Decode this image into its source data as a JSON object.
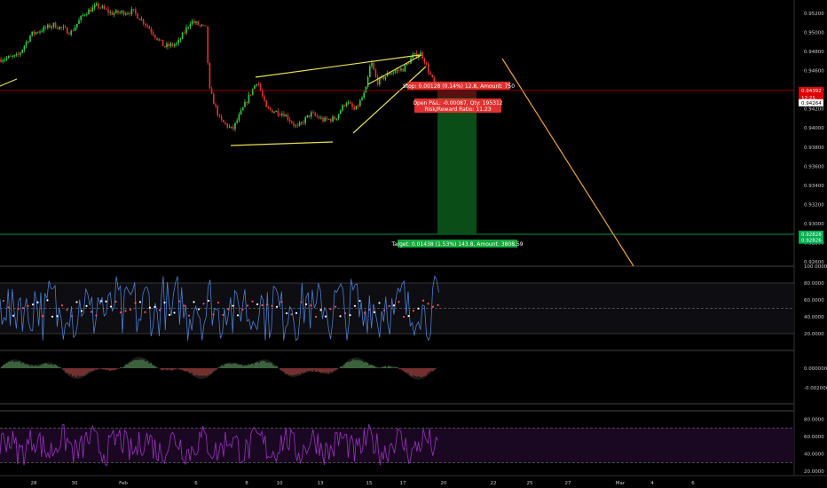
{
  "chart_data": {
    "type": "candlestick",
    "price_axis": {
      "min": 0.926,
      "max": 0.952,
      "ticks": [
        "0.95200",
        "0.95000",
        "0.94800",
        "0.94600",
        "0.94400",
        "0.94200",
        "0.94000",
        "0.93800",
        "0.93600",
        "0.93400",
        "0.93200",
        "0.93000",
        "0.92800",
        "0.92600"
      ],
      "tick_values": [
        0.952,
        0.95,
        0.948,
        0.946,
        0.944,
        0.942,
        0.94,
        0.938,
        0.936,
        0.934,
        0.932,
        0.93,
        0.928,
        0.926
      ]
    },
    "price_markers": [
      {
        "label": "0.94392",
        "value": 0.94392,
        "color": "#e00000"
      },
      {
        "label": "12:25",
        "value": 0.9432,
        "color": "#e00000"
      },
      {
        "label": "0.94264",
        "value": 0.94264,
        "color": "#ffffff",
        "text": "#000000"
      },
      {
        "label": "0.92828",
        "value": 0.92888,
        "color": "#00b050"
      },
      {
        "label": "0.92826",
        "value": 0.92826,
        "color": "#00b050"
      }
    ],
    "x_axis_labels": [
      "28",
      "30",
      "Feb",
      "6",
      "8",
      "10",
      "13",
      "15",
      "17",
      "20",
      "22",
      "25",
      "27",
      "Mar",
      "4",
      "6"
    ],
    "x_axis_positions": [
      38,
      84,
      139,
      221,
      278,
      315,
      361,
      416,
      454,
      500,
      556,
      597,
      640,
      699,
      735,
      781
    ],
    "position": {
      "entry": 0.9432,
      "stop": 0.94448,
      "target": 0.92888,
      "stop_label": "Stop: 0.00128 (0.14%) 12.8, Amount: 750",
      "open_label": "Open P&L: -0.00087, Qty: 195312",
      "rr_label": "Risk/Reward Ratio: 11.23",
      "target_label": "Target: 0.01438 (1.53%) 143.8, Amount: 3808.59"
    },
    "oscillator1": {
      "ticks": [
        "100.0000",
        "80.0000",
        "60.0000",
        "40.0000",
        "20.0000"
      ],
      "tick_values": [
        100,
        80,
        60,
        40,
        20
      ],
      "levels": [
        80,
        50,
        20
      ]
    },
    "oscillator2": {
      "ticks": [
        "0.000000",
        "-0.002000"
      ],
      "tick_values": [
        0,
        -0.002
      ]
    },
    "oscillator3": {
      "ticks": [
        "80.0000",
        "60.0000",
        "40.0000",
        "20.0000"
      ],
      "tick_values": [
        80,
        60,
        40,
        20
      ]
    },
    "colors": {
      "up": "#2ecc40",
      "down": "#e0312e",
      "wedge": "#e8e050",
      "projection": "#f5a030",
      "entry_line": "#c00000",
      "target_line": "#00c060",
      "osc1": "#4a7fd0",
      "osc3": "#9b30c0"
    }
  }
}
